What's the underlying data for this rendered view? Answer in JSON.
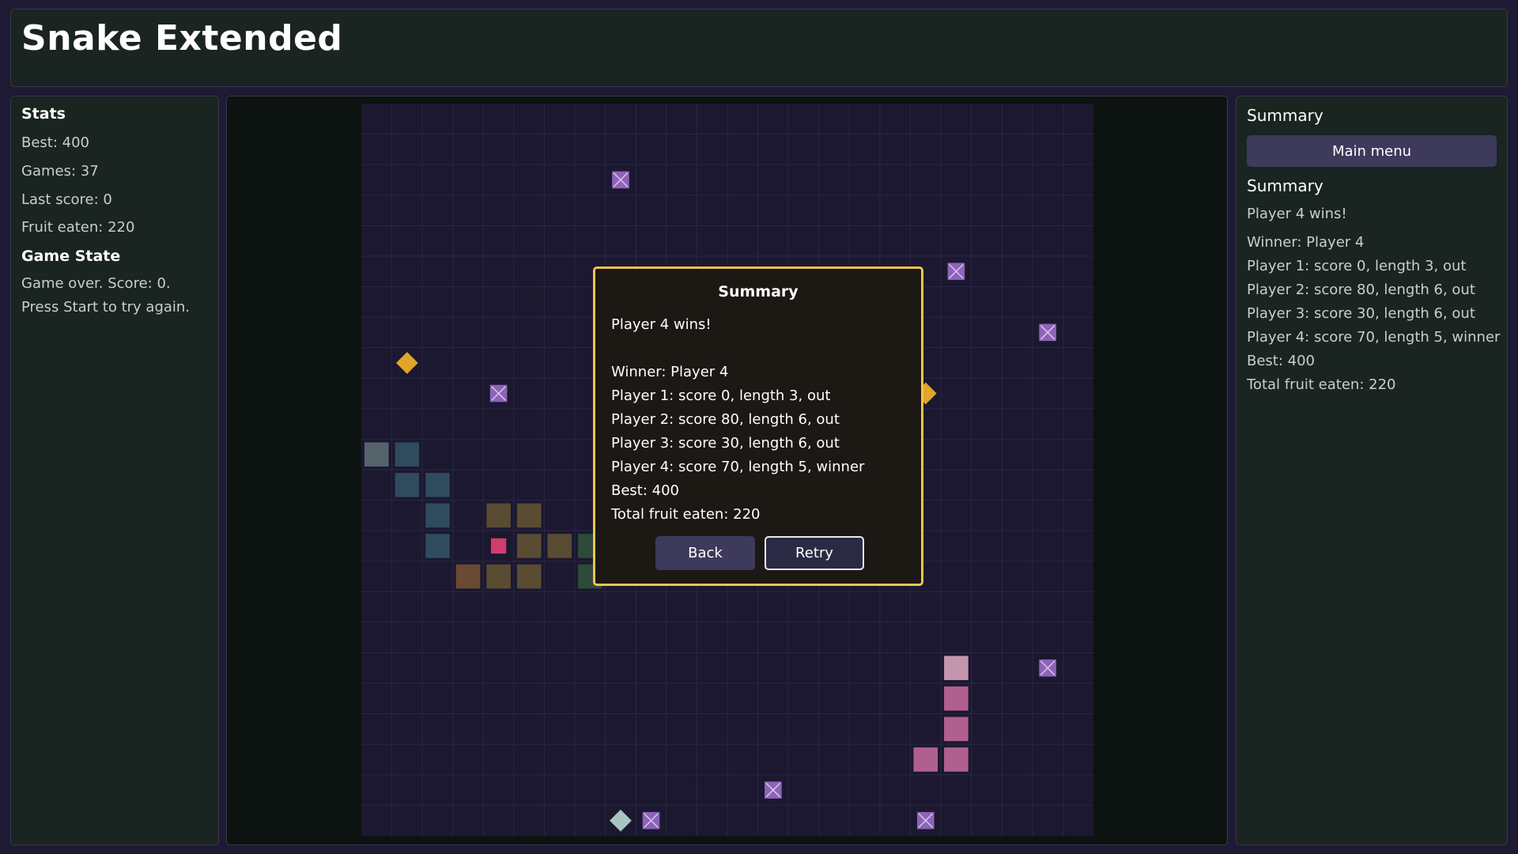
{
  "app": {
    "title": "Snake Extended"
  },
  "stats": {
    "heading": "Stats",
    "best": "Best: 400",
    "games": "Games: 37",
    "last_score": "Last score: 0",
    "fruit_eaten": "Fruit eaten: 220",
    "state_heading": "Game State",
    "state_line1": "Game over. Score: 0.",
    "state_line2": "Press Start to try again."
  },
  "summary_panel": {
    "heading": "Summary",
    "main_menu_label": "Main menu",
    "subheading": "Summary",
    "lines": [
      "Player 4 wins!",
      "Winner: Player 4",
      "Player 1: score 0, length 3, out",
      "Player 2: score 80, length 6, out",
      "Player 3: score 30, length 6, out",
      "Player 4: score 70, length 5, winner",
      "Best: 400",
      "Total fruit eaten: 220"
    ]
  },
  "modal": {
    "title": "Summary",
    "headline": "Player 4 wins!",
    "lines": [
      "Winner: Player 4",
      "Player 1: score 0, length 3, out",
      "Player 2: score 80, length 6, out",
      "Player 3: score 30, length 6, out",
      "Player 4: score 70, length 5, winner",
      "Best: 400",
      "Total fruit eaten: 220"
    ],
    "back_label": "Back",
    "retry_label": "Retry"
  },
  "board": {
    "cols": 24,
    "rows": 24,
    "colors": {
      "background": "#1b1830",
      "grid": "#2a2745",
      "modal_border": "#f2c34e",
      "button": "#3d3a5c"
    },
    "snakes": [
      {
        "player": "Player 1",
        "color": "#304a5e",
        "head_color": "#56636b",
        "segments": [
          [
            0,
            11
          ],
          [
            1,
            11
          ],
          [
            1,
            12
          ],
          [
            2,
            12
          ],
          [
            2,
            13
          ],
          [
            2,
            14
          ]
        ]
      },
      {
        "player": "Player 2",
        "color": "#5a4b33",
        "head_color": "#6b4a33",
        "segments": [
          [
            3,
            15
          ],
          [
            4,
            15
          ],
          [
            5,
            15
          ],
          [
            5,
            14
          ],
          [
            6,
            14
          ],
          [
            5,
            13
          ],
          [
            4,
            13
          ]
        ]
      },
      {
        "player": "Player 3",
        "color": "#2e4a38",
        "segments": [
          [
            7,
            14
          ],
          [
            7,
            15
          ]
        ]
      },
      {
        "player": "Player 4",
        "color": "#b0608f",
        "head_color": "#c496ad",
        "segments": [
          [
            19,
            18
          ],
          [
            19,
            19
          ],
          [
            19,
            20
          ],
          [
            19,
            21
          ],
          [
            18,
            21
          ]
        ]
      }
    ],
    "fruits": [
      {
        "kind": "pink-square",
        "color": "#d13d6e",
        "cell": [
          4,
          14
        ]
      },
      {
        "kind": "gold-diamond",
        "color": "#e0a52a",
        "cell": [
          1,
          8
        ]
      },
      {
        "kind": "gold-diamond",
        "color": "#e0a52a",
        "cell": [
          18,
          9
        ]
      },
      {
        "kind": "teal-diamond",
        "color": "#a8c4c0",
        "cell": [
          8,
          23
        ]
      }
    ],
    "obstacles": {
      "color": "#8e63b8",
      "cells": [
        [
          8,
          2
        ],
        [
          19,
          5
        ],
        [
          22,
          7
        ],
        [
          4,
          9
        ],
        [
          22,
          18
        ],
        [
          13,
          22
        ],
        [
          9,
          23
        ],
        [
          18,
          23
        ]
      ]
    }
  }
}
